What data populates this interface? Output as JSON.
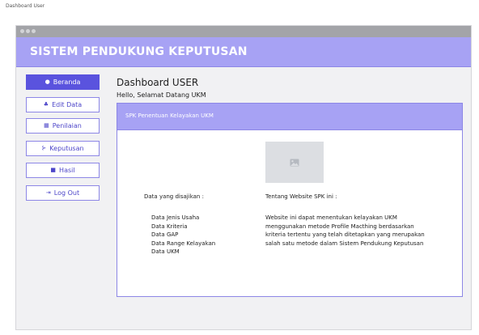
{
  "page": {
    "caption": "Dashboard User"
  },
  "header": {
    "title": "SISTEM PENDUKUNG KEPUTUSAN"
  },
  "nav": [
    {
      "label": "Beranda",
      "icon": "palette-icon",
      "glyph": "●",
      "active": true
    },
    {
      "label": "Edit Data",
      "icon": "users-icon",
      "glyph": "♣",
      "active": false
    },
    {
      "label": "Penilaian",
      "icon": "grid-icon",
      "glyph": "▦",
      "active": false
    },
    {
      "label": "Keputusan",
      "icon": "flow-icon",
      "glyph": "⊱",
      "active": false
    },
    {
      "label": "Hasil",
      "icon": "square-icon",
      "glyph": "■",
      "active": false
    },
    {
      "label": "Log Out",
      "icon": "logout-icon",
      "glyph": "⇥",
      "active": false
    }
  ],
  "main": {
    "title": "Dashboard USER",
    "subtitle": "Hello, Selamat Datang UKM",
    "panel": {
      "title": "SPK Penentuan Kelayakan UKM",
      "left_heading": "Data yang disajikan :",
      "left_items": [
        "Data Jenis Usaha",
        "Data Kriteria",
        "Data GAP",
        "Data Range Kelayakan",
        "Data UKM"
      ],
      "right_heading": "Tentang Website SPK ini :",
      "right_lines": [
        "Website ini dapat menentukan kelayakan UKM",
        "menggunakan metode Profile Macthing berdasarkan",
        "kriteria tertentu yang telah ditetapkan yang merupakan",
        "salah satu metode dalam Sistem Pendukung Keputusan"
      ]
    }
  },
  "colors": {
    "accent": "#5a53de",
    "header_bg": "#a7a2f4",
    "border": "#8d87e6",
    "window_bg": "#f1f1f3"
  }
}
